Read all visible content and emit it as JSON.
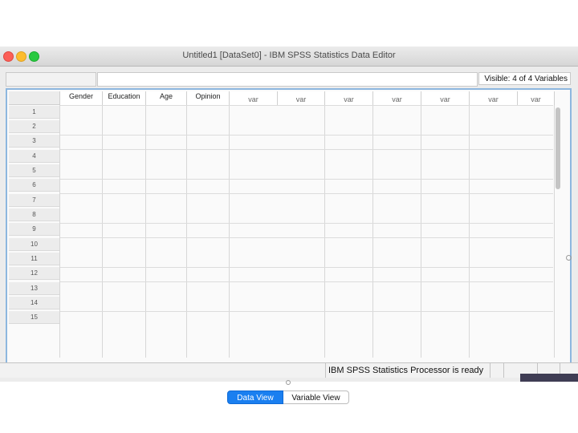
{
  "window": {
    "title": "Untitled1 [DataSet0] - IBM SPSS Statistics Data Editor"
  },
  "toolbar": {
    "cell_reference": "",
    "cell_value": "",
    "visible_text": "Visible: 4 of 4 Variables"
  },
  "grid": {
    "columns": [
      "Gender",
      "Education",
      "Age",
      "Opinion",
      "var",
      "var",
      "var",
      "var",
      "var",
      "var",
      "var"
    ],
    "rows": [
      "1",
      "2",
      "3",
      "4",
      "5",
      "6",
      "7",
      "8",
      "9",
      "10",
      "11",
      "12",
      "13",
      "14",
      "15"
    ]
  },
  "tabs": {
    "data_view": "Data View",
    "variable_view": "Variable View"
  },
  "status": {
    "processor": "IBM SPSS Statistics Processor is ready"
  },
  "colors": {
    "active_tab": "#1a7ff0",
    "grid_border": "#8db7df"
  }
}
